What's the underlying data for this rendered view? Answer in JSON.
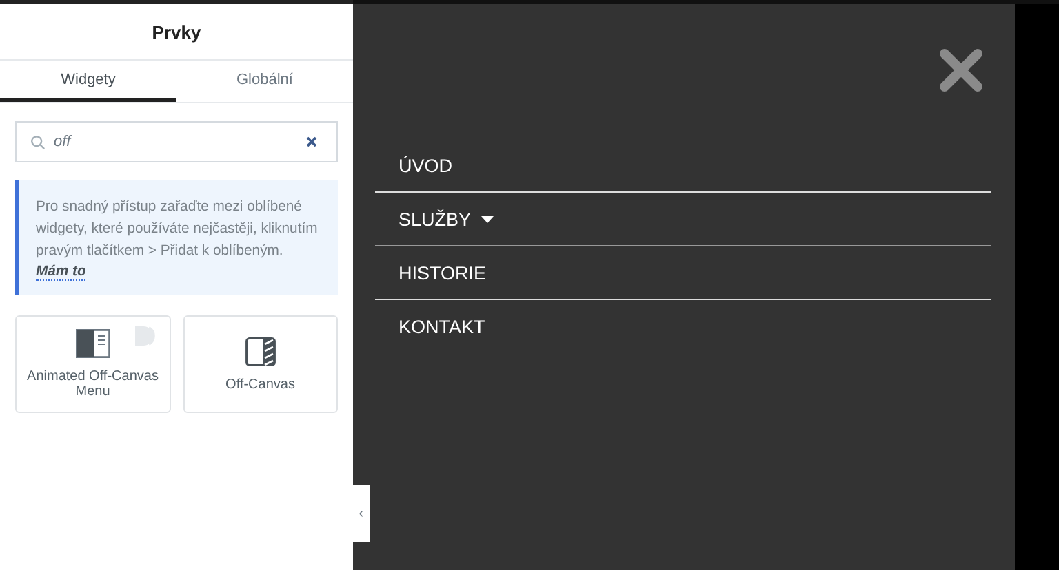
{
  "panel": {
    "title": "Prvky",
    "tabs": [
      {
        "label": "Widgety",
        "selected": true
      },
      {
        "label": "Globální",
        "selected": false
      }
    ],
    "search": {
      "value": "off"
    },
    "notice": {
      "text": "Pro snadný přístup zařaďte mezi oblíbené widgety, které používáte nejčastěji, kliknutím pravým tlačítkem > Přidat k oblíbeným.",
      "link": "Mám to"
    },
    "widgets": [
      {
        "label": "Animated Off-Canvas Menu",
        "kind": "menu",
        "pro": true
      },
      {
        "label": "Off-Canvas",
        "kind": "canvas",
        "pro": false
      }
    ],
    "collapse": "‹"
  },
  "menu": {
    "items": [
      {
        "label": "ÚVOD",
        "dropdown": false
      },
      {
        "label": "SLUŽBY",
        "dropdown": true
      },
      {
        "label": "HISTORIE",
        "dropdown": false
      },
      {
        "label": "KONTAKT",
        "dropdown": false
      }
    ]
  }
}
